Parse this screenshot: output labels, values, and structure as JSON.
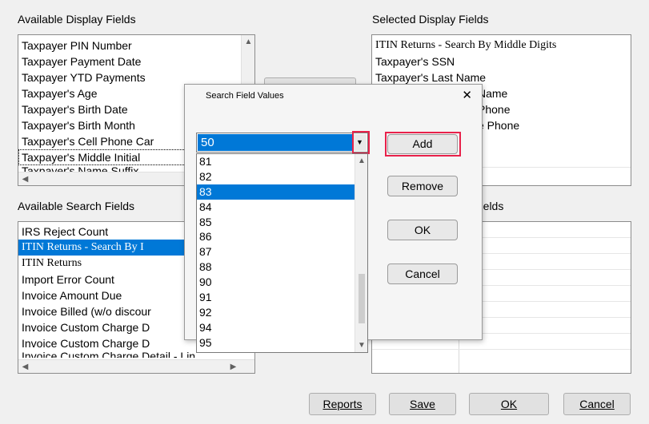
{
  "available_display": {
    "label": "Available Display Fields",
    "items": [
      "Taxpayer PIN Number",
      "Taxpayer Payment Date",
      "Taxpayer YTD Payments",
      "Taxpayer's Age",
      "Taxpayer's Birth Date",
      "Taxpayer's Birth Month",
      "Taxpayer's Cell Phone Car",
      "Taxpayer's Middle Initial",
      "Taxpayer's Name Suffix"
    ]
  },
  "selected_display": {
    "label": "Selected Display Fields",
    "items": [
      "ITIN Returns - Search By Middle Digits",
      "Taxpayer's SSN",
      "Taxpayer's Last Name",
      "Name",
      "Phone",
      "e Phone"
    ]
  },
  "add_partial_label": "Add",
  "available_search": {
    "label": "Available Search Fields",
    "items": [
      "IRS Reject Count",
      "ITIN Returns - Search By I",
      "ITIN Returns",
      "Import Error Count",
      "Invoice Amount Due",
      "Invoice Billed (w/o discour",
      "Invoice Custom Charge D",
      "Invoice Custom Charge D",
      "Invoice Custom Charge Detail - Lin"
    ]
  },
  "selected_search": {
    "label_partial": "Fields"
  },
  "dialog": {
    "title": "Search Field Values",
    "close": "✕",
    "selected_value": "50",
    "options": [
      "81",
      "82",
      "83",
      "84",
      "85",
      "86",
      "87",
      "88",
      "90",
      "91",
      "92",
      "94",
      "95"
    ],
    "highlighted_option": "83",
    "add_label": "Add",
    "remove_label": "Remove",
    "ok_label": "OK",
    "cancel_label": "Cancel"
  },
  "footer": {
    "reports_label": "Reports",
    "save_label": "Save",
    "ok_label": "OK",
    "cancel_label": "Cancel"
  },
  "colors": {
    "selection": "#0078d7",
    "highlight_box": "#e8214a"
  }
}
